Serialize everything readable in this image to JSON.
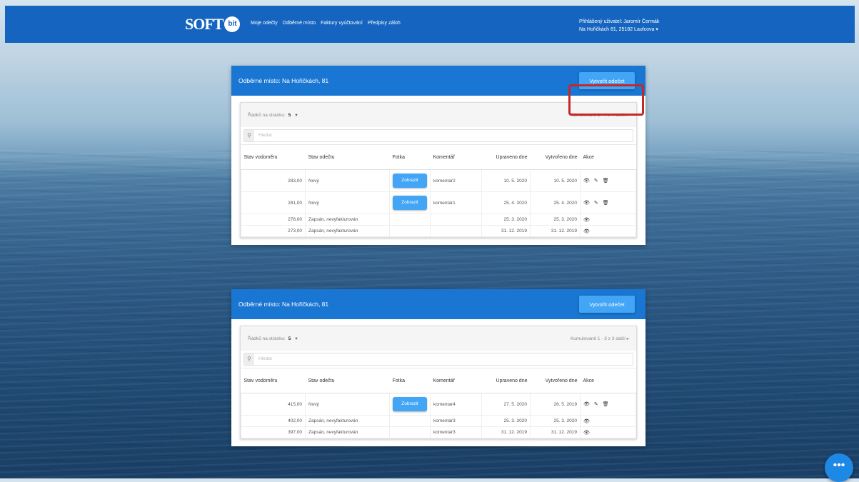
{
  "navbar": {
    "logo_text": "SOFT",
    "logo_sub": "bit",
    "links": [
      "Moje odečty",
      "Odběrné místo",
      "Faktury vyúčtování",
      "Předpisy záloh"
    ],
    "user_line1": "Přihlášený uživatel: Jaromír Čermák",
    "user_line2": "Na Hořičkách 81, 25182 Laufcova"
  },
  "cards": [
    {
      "title": "Odběrné místo: Na Hořičkách, 81",
      "create_label": "Vytvořit odečet",
      "per_page_label": "Řádků na stránku:",
      "per_page_value": "5",
      "paging": "Kumulovaně   1 - 4 z 4   další ▸",
      "search_placeholder": "Hledat",
      "headers": [
        "Stav vodoměru",
        "Stav odečtu",
        "Fotka",
        "Komentář",
        "Upraveno dne",
        "Vytvořeno dne",
        "Akce"
      ],
      "rows": [
        {
          "meter": "283,00",
          "state": "Nový",
          "photo": "Zobrazit",
          "comment": "komentar2",
          "modified": "10. 5. 2020",
          "created": "10. 5. 2020",
          "edit": true
        },
        {
          "meter": "281,00",
          "state": "Nový",
          "photo": "Zobrazit",
          "comment": "komentar1",
          "modified": "25. 4. 2020",
          "created": "25. 4. 2020",
          "edit": true
        },
        {
          "meter": "278,00",
          "state": "Zapsán, nevyfakturován",
          "photo": "",
          "comment": "",
          "modified": "25. 3. 2020",
          "created": "25. 3. 2020",
          "edit": false
        },
        {
          "meter": "273,00",
          "state": "Zapsán, nevyfakturován",
          "photo": "",
          "comment": "",
          "modified": "31. 12. 2019",
          "created": "31. 12. 2019",
          "edit": false
        }
      ]
    },
    {
      "title": "Odběrné místo: Na Hořičkách, 81",
      "create_label": "Vytvořit odečet",
      "per_page_label": "Řádků na stránku:",
      "per_page_value": "5",
      "paging": "Kumulovaně   1 - 3 z 3   další ▸",
      "search_placeholder": "Hledat",
      "headers": [
        "Stav vodoměru",
        "Stav odečtu",
        "Fotka",
        "Komentář",
        "Upraveno dne",
        "Vytvořeno dne",
        "Akce"
      ],
      "rows": [
        {
          "meter": "415,00",
          "state": "Nový",
          "photo": "Zobrazit",
          "comment": "komentar4",
          "modified": "27. 5. 2020",
          "created": "26. 5. 2019",
          "edit": true
        },
        {
          "meter": "402,00",
          "state": "Zapsán, nevyfakturován",
          "photo": "",
          "comment": "komentar3",
          "modified": "25. 3. 2020",
          "created": "25. 3. 2020",
          "edit": false
        },
        {
          "meter": "397,00",
          "state": "Zapsán, nevyfakturován",
          "photo": "",
          "comment": "komentar3",
          "modified": "31. 12. 2019",
          "created": "31. 12. 2019",
          "edit": false
        }
      ]
    }
  ],
  "fab_label": "•••",
  "colors": {
    "navbar": "#1565c0",
    "card_header": "#1976d2",
    "button": "#42a5f5",
    "highlight": "#c62828"
  }
}
